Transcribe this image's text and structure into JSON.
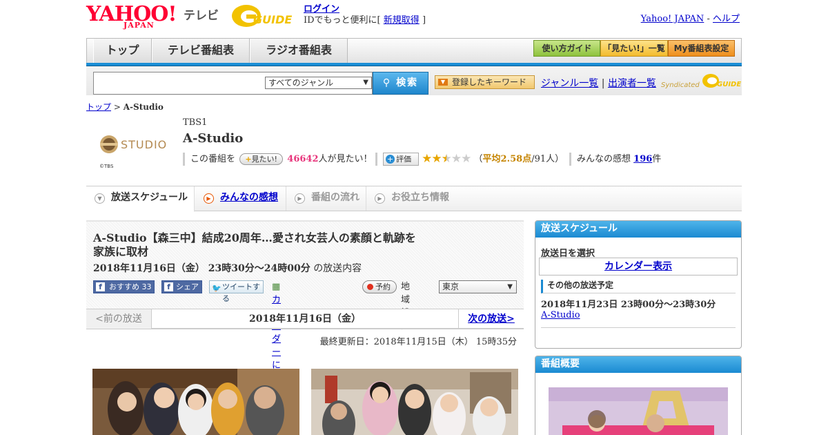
{
  "header": {
    "yahoo_logo": "YAHOO!",
    "yahoo_sub": "JAPAN",
    "tv_label": "テレビ",
    "gguide_logo": "GUIDE",
    "login_link": "ログイン",
    "login_text": "IDでもっと便利に[",
    "signup_link": "新規取得",
    "login_close": "]",
    "yahoo_japan_link": "Yahoo! JAPAN",
    "sep": "-",
    "help_link": "ヘルプ"
  },
  "nav": {
    "tabs": [
      "トップ",
      "テレビ番組表",
      "ラジオ番組表"
    ],
    "guide_buttons": [
      "使い方ガイド",
      "「見たい!」一覧",
      "My番組表設定"
    ]
  },
  "search": {
    "genre_selected": "すべてのジャンル",
    "button_label": "検索",
    "keyword_button": "登録したキーワード",
    "genre_list_link": "ジャンル一覧",
    "divider": "|",
    "performer_list_link": "出演者一覧",
    "syndicated": "Syndicated"
  },
  "breadcrumb": {
    "top_link": "トップ",
    "sep": ">",
    "current": "A-Studio"
  },
  "program": {
    "logo_text": "STUDIO",
    "copyright": "©TBS",
    "channel": "TBS1",
    "title": "A-Studio",
    "want_prefix": "この番組を",
    "want_button": "見たい!",
    "want_count": "46642",
    "want_suffix": "人が見たい！",
    "rating_button": "評価",
    "rating_stars": 2.58,
    "rating_open": "（",
    "rating_avg": "平均2.58点",
    "rating_count": "/91人）",
    "impressions_label": "みんなの感想",
    "impressions_count": "196",
    "impressions_unit": "件"
  },
  "content_tabs": [
    "放送スケジュール",
    "みんなの感想",
    "番組の流れ",
    "お役立ち情報"
  ],
  "episode": {
    "title": "A-Studio【森三中】結成20周年…愛され女芸人の素顔と軌跡を家族に取材",
    "date": "2018年11月16日（金） 23時30分～24時00分",
    "date_suffix": "の放送内容",
    "fb_recommend": "おすすめ 33",
    "fb_share": "シェア",
    "tweet": "ツイートする",
    "calendar_register": "カレンダーに登録",
    "reserve": "予約",
    "region_label": "地域設定",
    "region_selected": "東京"
  },
  "pager": {
    "prev": "<前の放送",
    "current": "2018年11月16日（金）",
    "next": "次の放送>"
  },
  "updated": "最終更新日：2018年11月15日（木） 15時35分",
  "sidebar": {
    "schedule_title": "放送スケジュール",
    "select_date": "放送日を選択",
    "calendar_link": "カレンダー表示",
    "other_schedule": "その他の放送予定",
    "next_date": "2018年11月23日 23時00分～23時30分",
    "next_link": "A-Studio",
    "overview_title": "番組概要"
  },
  "colors": {
    "accent_blue": "#1a8ed6",
    "pink": "#e8367c",
    "star": "#e7a500"
  }
}
